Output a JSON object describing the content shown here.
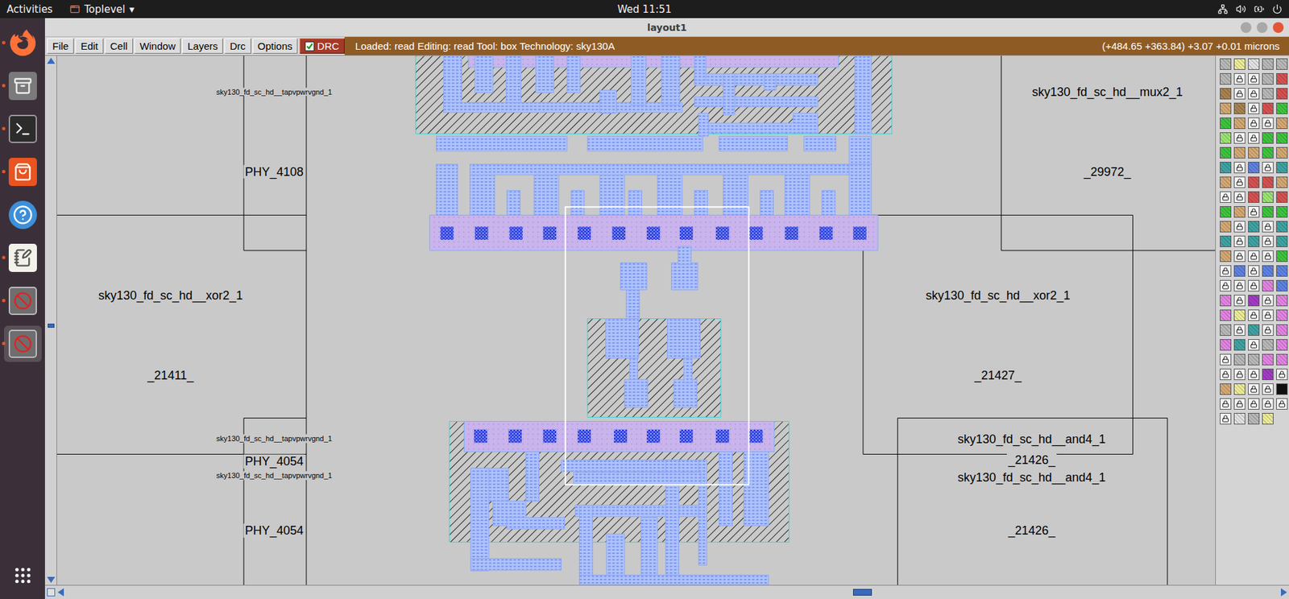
{
  "topbar": {
    "activities": "Activities",
    "app_menu": "Toplevel",
    "app_menu_arrow": "▾",
    "clock": "Wed 11:51"
  },
  "dock": [
    {
      "kind": "browser",
      "running": true,
      "selected": false
    },
    {
      "kind": "files",
      "running": true,
      "selected": false
    },
    {
      "kind": "terminal",
      "running": true,
      "selected": false
    },
    {
      "kind": "software",
      "running": true,
      "selected": false
    },
    {
      "kind": "help",
      "running": false,
      "selected": false
    },
    {
      "kind": "editor",
      "running": true,
      "selected": false
    },
    {
      "kind": "tk",
      "running": true,
      "selected": false
    },
    {
      "kind": "tk",
      "running": true,
      "selected": true
    }
  ],
  "window": {
    "title": "layout1"
  },
  "menu": [
    "File",
    "Edit",
    "Cell",
    "Window",
    "Layers",
    "Drc",
    "Options"
  ],
  "drc": {
    "label": "DRC",
    "checked": true
  },
  "status": "Loaded: read Editing: read Tool: box Technology: sky130A",
  "coordinates": "(+484.65 +363.84) +3.07 +0.01 microns",
  "scrollbars": {
    "vertical_position": 0.51,
    "horizontal_position": 0.66
  },
  "cells": [
    {
      "kind": "tap",
      "type": "sky130_fd_sc_hd__tapvpwrvgnd_1",
      "instance": "PHY_4108"
    },
    {
      "kind": "std",
      "type": "sky130_fd_sc_hd__xor2_1",
      "instance": "_21411_"
    },
    {
      "kind": "tap",
      "type": "sky130_fd_sc_hd__tapvpwrvgnd_1",
      "instance": "PHY_4054"
    },
    {
      "kind": "tap",
      "type": "sky130_fd_sc_hd__tapvpwrvgnd_1",
      "instance": "PHY_4054"
    },
    {
      "kind": "std",
      "type": "sky130_fd_sc_hd__mux2_1",
      "instance": "_29972_"
    },
    {
      "kind": "std",
      "type": "sky130_fd_sc_hd__xor2_1",
      "instance": "_21427_"
    },
    {
      "kind": "std",
      "type": "sky130_fd_sc_hd__and4_1",
      "instance": "_21426_"
    },
    {
      "kind": "std",
      "type": "sky130_fd_sc_hd__and4_1",
      "instance": "_21426_"
    }
  ]
}
